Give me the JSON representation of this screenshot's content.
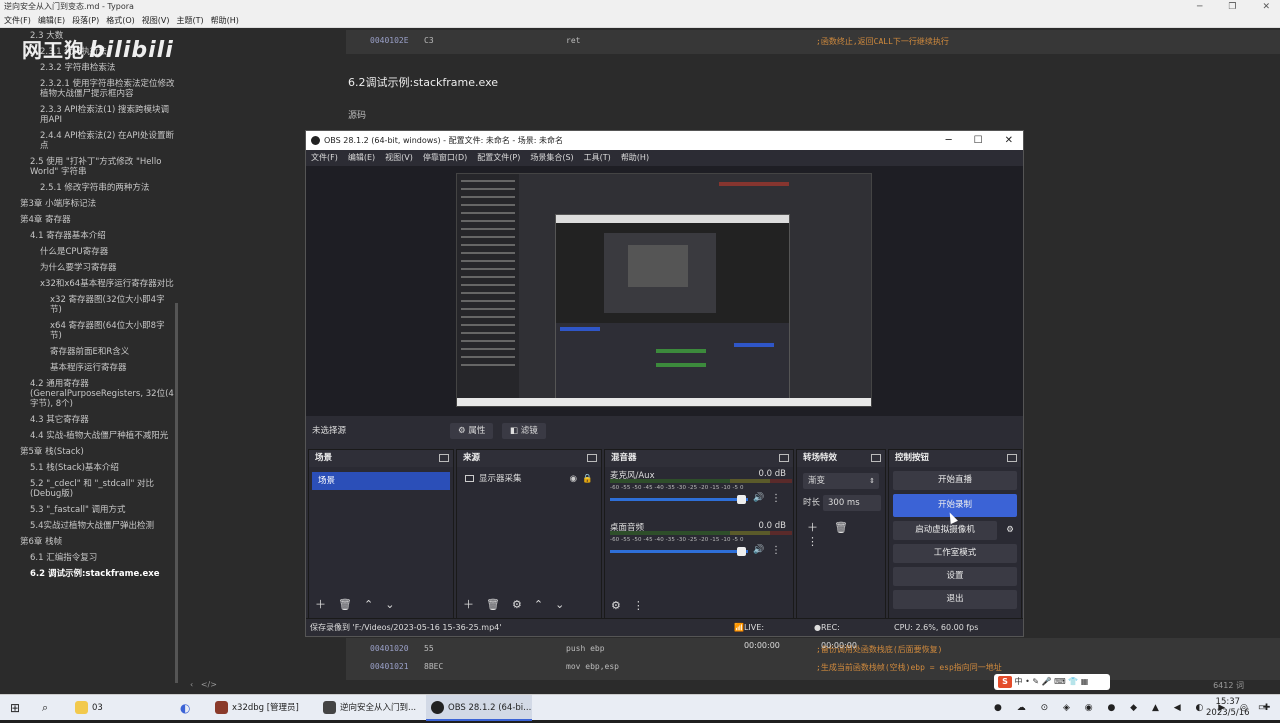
{
  "typora": {
    "window_title": "逆向安全从入门到变态.md - Typora",
    "menu": [
      "文件(F)",
      "编辑(E)",
      "段落(P)",
      "格式(O)",
      "视图(V)",
      "主题(T)",
      "帮助(H)"
    ],
    "outline": [
      {
        "label": "2.3 大数",
        "active": false
      },
      {
        "label": "2.3.1 代码执行法",
        "active": false
      },
      {
        "label": "2.3.2 字符串检索法",
        "active": false
      },
      {
        "label": "2.3.2.1 使用字符串检索法定位修改植物大战僵尸提示框内容",
        "active": false
      },
      {
        "label": "2.3.3 API检索法(1) 搜索跨模块调用API",
        "active": false
      },
      {
        "label": "2.4.4 API检索法(2) 在API处设置断点",
        "active": false
      },
      {
        "label": "2.5 使用 \"打补丁\"方式修改 \"Hello World\" 字符串",
        "active": false
      },
      {
        "label": "2.5.1 修改字符串的两种方法",
        "active": false
      },
      {
        "label": "第3章 小端序标记法",
        "active": false
      },
      {
        "label": "第4章 寄存器",
        "active": false
      },
      {
        "label": "4.1 寄存器基本介绍",
        "active": false
      },
      {
        "label": "什么是CPU寄存器",
        "active": false
      },
      {
        "label": "为什么要学习寄存器",
        "active": false
      },
      {
        "label": "x32和x64基本程序运行寄存器对比",
        "active": false
      },
      {
        "label": "x32 寄存器图(32位大小即4字节)",
        "active": false
      },
      {
        "label": "x64 寄存器图(64位大小即8字节)",
        "active": false
      },
      {
        "label": "寄存器前面E和R含义",
        "active": false
      },
      {
        "label": "基本程序运行寄存器",
        "active": false
      },
      {
        "label": "4.2 通用寄存器(GeneralPurposeRegisters, 32位(4字节), 8个)",
        "active": false
      },
      {
        "label": "4.3 其它寄存器",
        "active": false
      },
      {
        "label": "4.4 实战-植物大战僵尸种植不减阳光",
        "active": false
      },
      {
        "label": "第5章 栈(Stack)",
        "active": false
      },
      {
        "label": "5.1 栈(Stack)基本介绍",
        "active": false
      },
      {
        "label": "5.2 \"_cdecl\" 和 \"_stdcall\" 对比(Debug版)",
        "active": false
      },
      {
        "label": "5.3 \"_fastcall\" 调用方式",
        "active": false
      },
      {
        "label": "5.4实战过植物大战僵尸弹出检测",
        "active": false
      },
      {
        "label": "第6章 栈帧",
        "active": false
      },
      {
        "label": "6.1 汇编指令复习",
        "active": false
      },
      {
        "label": "6.2 调试示例:stackframe.exe",
        "active": true
      }
    ],
    "watermark": {
      "left": "网工狍",
      "right": "bilibili"
    },
    "code_top": {
      "addr": "0040102E",
      "bytes": "C3",
      "instr": "ret",
      "comment": ";函数终止,返回CALL下一行继续执行"
    },
    "heading": "6.2调试示例:stackframe.exe",
    "source_label": "源码",
    "code_rows": [
      {
        "addr": "00401020",
        "bytes": "55",
        "instr": "push ebp",
        "comment": ";备份调用处函数栈底(后面要恢复)"
      },
      {
        "addr": "00401021",
        "bytes": "8BEC",
        "instr": "mov ebp,esp",
        "comment": ";生成当前函数栈帧(空栈)ebp = esp指向同一地址"
      }
    ],
    "word_count": "6412 词"
  },
  "obs": {
    "title": "OBS 28.1.2 (64-bit, windows) - 配置文件: 未命名 - 场景: 未命名",
    "menu": [
      "文件(F)",
      "编辑(E)",
      "视图(V)",
      "停靠窗口(D)",
      "配置文件(P)",
      "场景集合(S)",
      "工具(T)",
      "帮助(H)"
    ],
    "no_source": "未选择源",
    "properties": "属性",
    "filters": "滤镜",
    "docks": {
      "scenes": {
        "title": "场景",
        "items": [
          "场景"
        ]
      },
      "sources": {
        "title": "来源",
        "items": [
          "显示器采集"
        ]
      },
      "mixer": {
        "title": "混音器",
        "channels": [
          {
            "name": "麦克风/Aux",
            "db": "0.0 dB"
          },
          {
            "name": "桌面音频",
            "db": "0.0 dB"
          }
        ],
        "scale": "-60 -55 -50 -45 -40 -35 -30 -25 -20 -15 -10 -5 0"
      },
      "transitions": {
        "title": "转场特效",
        "type": "渐变",
        "duration_label": "时长",
        "duration": "300 ms"
      },
      "controls": {
        "title": "控制按钮",
        "start_stream": "开始直播",
        "start_record": "开始录制",
        "virtual_cam": "启动虚拟摄像机",
        "studio_mode": "工作室模式",
        "settings": "设置",
        "exit": "退出"
      }
    },
    "status": {
      "saved": "保存录像到 'F:/Videos/2023-05-16 15-36-25.mp4'",
      "live": "LIVE: 00:00:00",
      "rec": "REC: 00:00:00",
      "cpu": "CPU: 2.6%, 60.00 fps"
    }
  },
  "taskbar": {
    "folder": "03",
    "apps": [
      {
        "label": "x32dbg [管理员]",
        "color": "#8a3a2a",
        "selected": false
      },
      {
        "label": "逆向安全从入门到...",
        "color": "#444",
        "selected": false
      },
      {
        "label": "OBS 28.1.2 (64-bi...",
        "color": "#222",
        "selected": true
      }
    ],
    "ime": "中",
    "time": "15:37",
    "date": "2023/5/16"
  }
}
